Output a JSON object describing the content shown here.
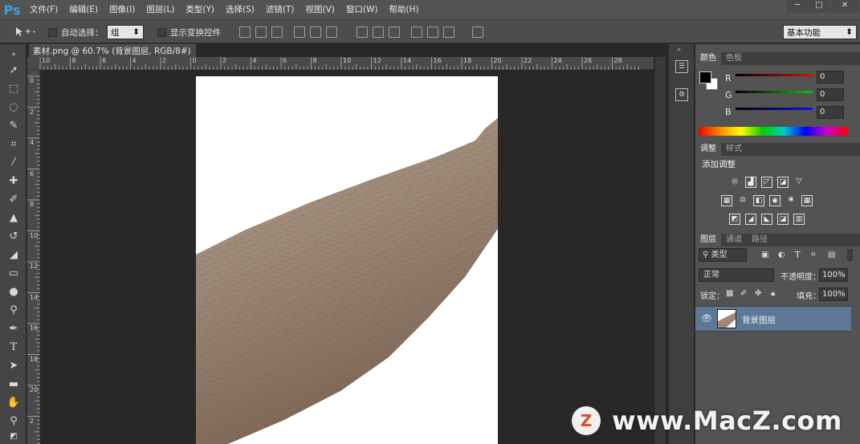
{
  "app": {
    "logo": "Ps",
    "menu": [
      "文件(F)",
      "编辑(E)",
      "图像(I)",
      "图层(L)",
      "类型(Y)",
      "选择(S)",
      "滤镜(T)",
      "视图(V)",
      "窗口(W)",
      "帮助(H)"
    ],
    "window_buttons": {
      "minimize": "─",
      "maximize": "□",
      "close": "✕"
    }
  },
  "options_bar": {
    "auto_select_label": "自动选择：",
    "auto_select_value": "组",
    "show_transform_label": "显示变换控件",
    "workspace": "基本功能"
  },
  "document": {
    "tab_title": "素材.png @ 60.7% (背景图层, RGB/8#) *",
    "tab_close": "×"
  },
  "rulers": {
    "h_ticks": [
      "10",
      "8",
      "6",
      "4",
      "2",
      "0",
      "2",
      "4",
      "6",
      "8",
      "10",
      "12",
      "14",
      "16",
      "18",
      "20",
      "22",
      "24",
      "26",
      "28"
    ],
    "v_ticks": [
      "0",
      "2",
      "4",
      "6",
      "8",
      "10",
      "12",
      "14",
      "16",
      "18",
      "20",
      "2"
    ]
  },
  "color_panel": {
    "tabs": [
      "颜色",
      "色板"
    ],
    "channels": [
      {
        "label": "R",
        "value": "0",
        "color": "#e01010"
      },
      {
        "label": "G",
        "value": "0",
        "color": "#10c010"
      },
      {
        "label": "B",
        "value": "0",
        "color": "#1010e0"
      }
    ]
  },
  "adjustments_panel": {
    "tabs": [
      "调整",
      "样式"
    ],
    "title": "添加调整"
  },
  "layers_panel": {
    "tabs": [
      "图层",
      "通道",
      "路径"
    ],
    "filter_label": "类型",
    "blend_mode": "正常",
    "opacity_label": "不透明度：",
    "opacity_value": "100%",
    "lock_label": "锁定：",
    "fill_label": "填充：",
    "fill_value": "100%",
    "layers": [
      {
        "name": "背景图层",
        "visible": true,
        "selected": true
      }
    ]
  },
  "watermark": {
    "text": "www.MacZ.com",
    "badge": "Z"
  }
}
